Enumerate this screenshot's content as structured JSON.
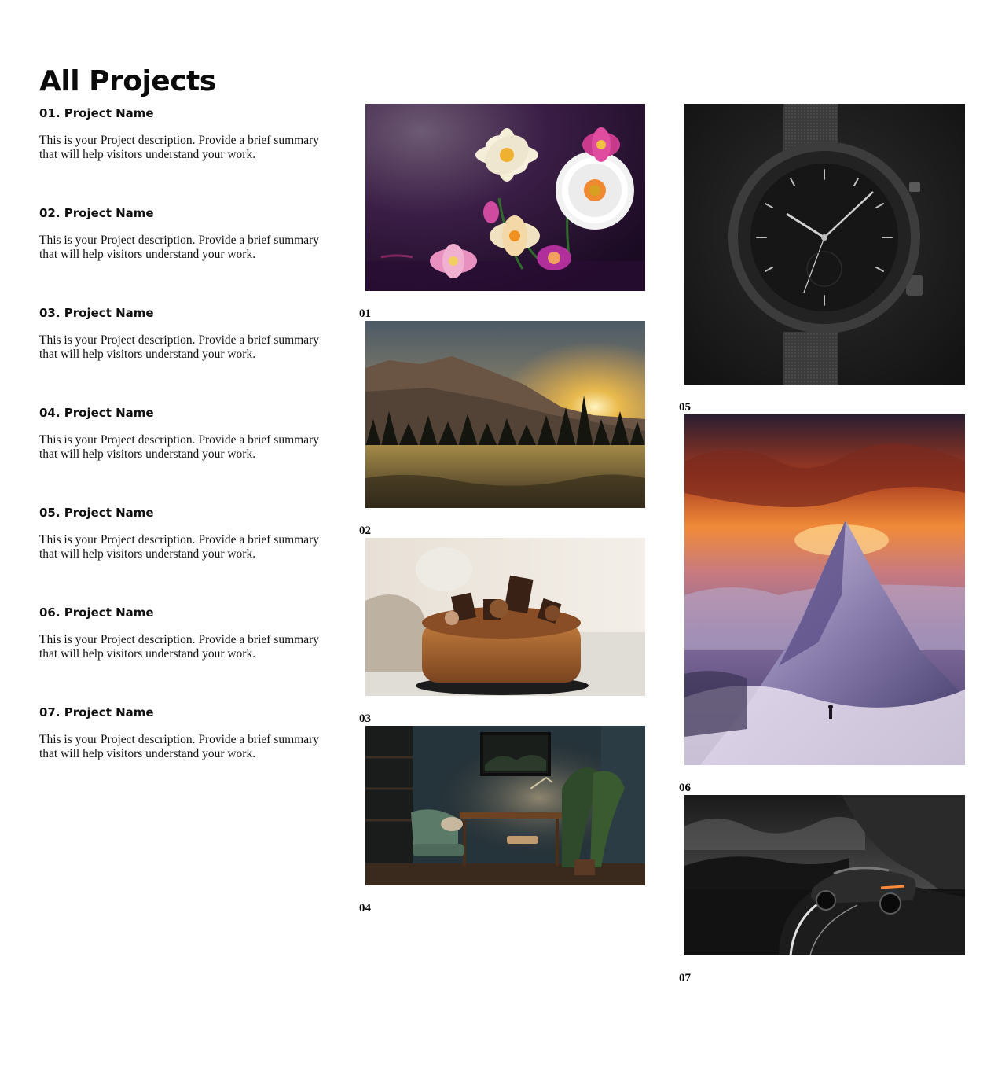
{
  "page": {
    "title": "All Projects"
  },
  "projects": [
    {
      "title": "01. Project Name",
      "description": "This is your Project description. Provide a brief summary that will help visitors understand your work."
    },
    {
      "title": "02. Project Name",
      "description": "This is your Project description. Provide a brief summary that will help visitors understand your work."
    },
    {
      "title": "03. Project Name",
      "description": "This is your Project description. Provide a brief summary that will help visitors understand your work."
    },
    {
      "title": "04. Project Name",
      "description": "This is your Project description. Provide a brief summary that will help visitors understand your work."
    },
    {
      "title": "05. Project Name",
      "description": "This is your Project description. Provide a brief summary that will help visitors understand your work."
    },
    {
      "title": "06. Project Name",
      "description": "This is your Project description. Provide a brief summary that will help visitors understand your work."
    },
    {
      "title": "07. Project Name",
      "description": "This is your Project description. Provide a brief summary that will help visitors understand your work."
    }
  ],
  "gallery": [
    {
      "number": "01",
      "image": "flowers-image"
    },
    {
      "number": "02",
      "image": "mountain-sunset-image"
    },
    {
      "number": "03",
      "image": "chocolate-cake-image"
    },
    {
      "number": "04",
      "image": "interior-room-image"
    },
    {
      "number": "05",
      "image": "wristwatch-image"
    },
    {
      "number": "06",
      "image": "mountain-peak-image"
    },
    {
      "number": "07",
      "image": "sports-car-image"
    }
  ]
}
